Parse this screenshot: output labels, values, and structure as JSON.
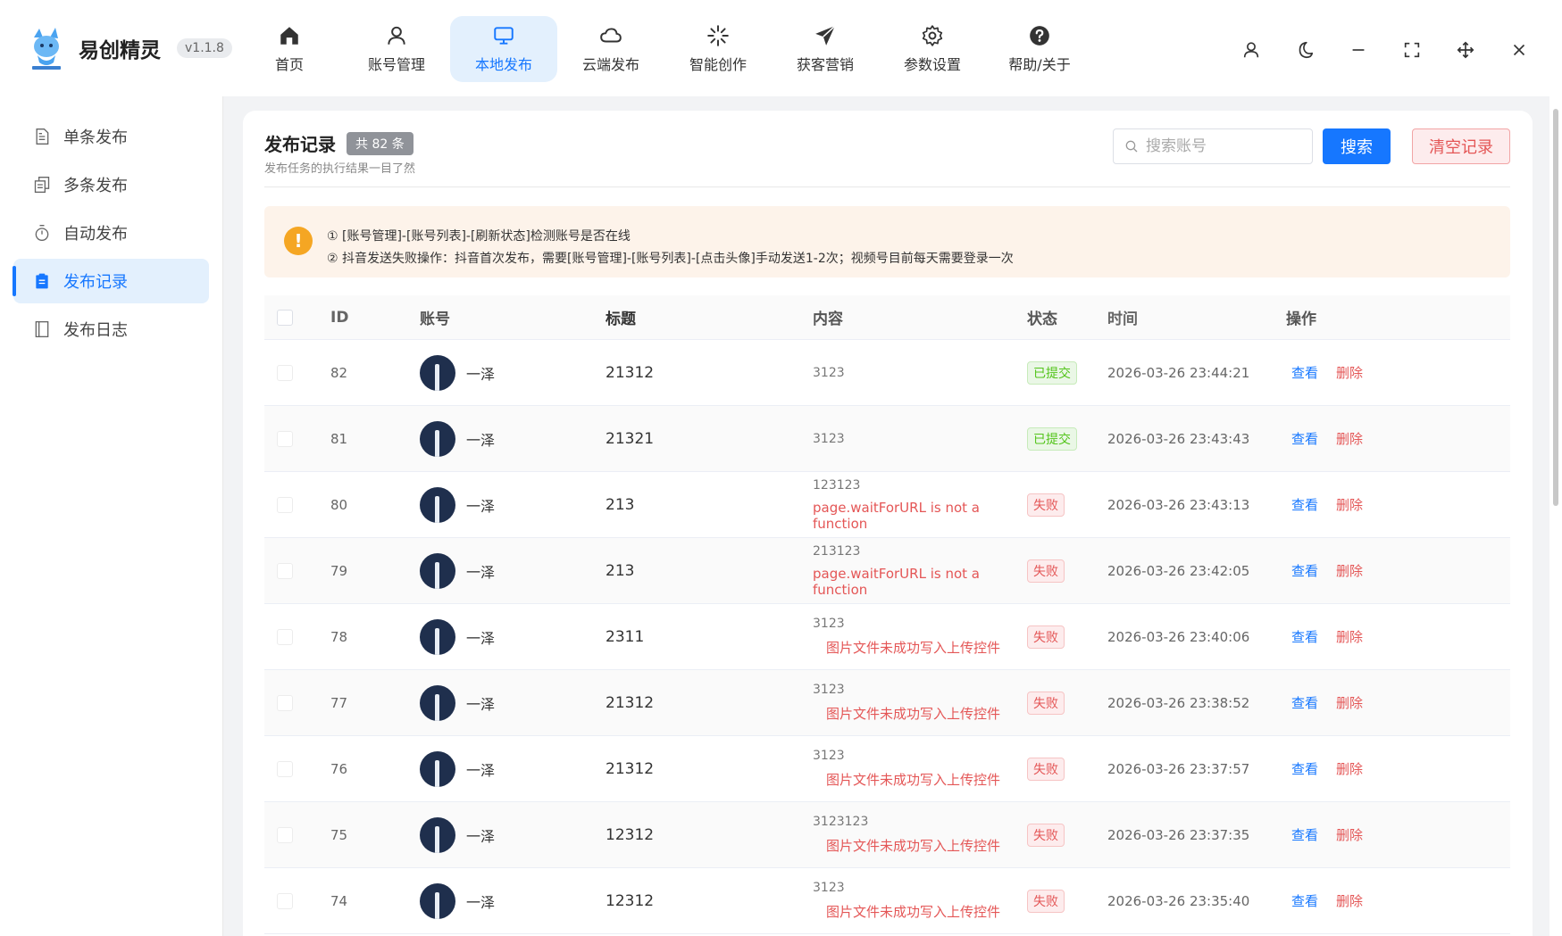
{
  "app": {
    "name": "易创精灵",
    "version": "v1.1.8"
  },
  "nav": [
    {
      "label": "首页",
      "icon": "home-icon",
      "active": false
    },
    {
      "label": "账号管理",
      "icon": "user-icon",
      "active": false
    },
    {
      "label": "本地发布",
      "icon": "monitor-icon",
      "active": true
    },
    {
      "label": "云端发布",
      "icon": "cloud-icon",
      "active": false
    },
    {
      "label": "智能创作",
      "icon": "sparkle-icon",
      "active": false
    },
    {
      "label": "获客营销",
      "icon": "paper-plane-icon",
      "active": false
    },
    {
      "label": "参数设置",
      "icon": "gear-icon",
      "active": false
    },
    {
      "label": "帮助/关于",
      "icon": "question-icon",
      "active": false
    }
  ],
  "window_controls": [
    "user-icon",
    "moon-icon",
    "minimize-icon",
    "fullscreen-icon",
    "move-icon",
    "close-icon"
  ],
  "sidebar": [
    {
      "label": "单条发布",
      "icon": "document-icon",
      "active": false
    },
    {
      "label": "多条发布",
      "icon": "copy-icon",
      "active": false
    },
    {
      "label": "自动发布",
      "icon": "timer-icon",
      "active": false
    },
    {
      "label": "发布记录",
      "icon": "clipboard-icon",
      "active": true
    },
    {
      "label": "发布日志",
      "icon": "notebook-icon",
      "active": false
    }
  ],
  "main": {
    "title": "发布记录",
    "count_badge": "共 82 条",
    "subtitle": "发布任务的执行结果一目了然",
    "search_placeholder": "搜索账号",
    "search_button": "搜索",
    "clear_button": "清空记录",
    "notice": {
      "icon": "!",
      "line1": "① [账号管理]-[账号列表]-[刷新状态]检测账号是否在线",
      "line2": "② 抖音发送失败操作：抖音首次发布，需要[账号管理]-[账号列表]-[点击头像]手动发送1-2次；视频号目前每天需要登录一次"
    },
    "columns": [
      "ID",
      "账号",
      "标题",
      "内容",
      "状态",
      "时间",
      "操作"
    ],
    "op_view": "查看",
    "op_delete": "删除",
    "rows": [
      {
        "id": "82",
        "account": "一泽",
        "title": "21312",
        "content": "3123",
        "error": "",
        "status": "已提交",
        "ok": true,
        "time": "2026-03-26 23:44:21"
      },
      {
        "id": "81",
        "account": "一泽",
        "title": "21321",
        "content": "3123",
        "error": "",
        "status": "已提交",
        "ok": true,
        "time": "2026-03-26 23:43:43"
      },
      {
        "id": "80",
        "account": "一泽",
        "title": "213",
        "content": "123123",
        "error": "page.waitForURL is not a function",
        "status": "失败",
        "ok": false,
        "time": "2026-03-26 23:43:13"
      },
      {
        "id": "79",
        "account": "一泽",
        "title": "213",
        "content": "213123",
        "error": "page.waitForURL is not a function",
        "status": "失败",
        "ok": false,
        "time": "2026-03-26 23:42:05"
      },
      {
        "id": "78",
        "account": "一泽",
        "title": "2311",
        "content": "3123",
        "error": "图片文件未成功写入上传控件",
        "status": "失败",
        "ok": false,
        "time": "2026-03-26 23:40:06"
      },
      {
        "id": "77",
        "account": "一泽",
        "title": "21312",
        "content": "3123",
        "error": "图片文件未成功写入上传控件",
        "status": "失败",
        "ok": false,
        "time": "2026-03-26 23:38:52"
      },
      {
        "id": "76",
        "account": "一泽",
        "title": "21312",
        "content": "3123",
        "error": "图片文件未成功写入上传控件",
        "status": "失败",
        "ok": false,
        "time": "2026-03-26 23:37:57"
      },
      {
        "id": "75",
        "account": "一泽",
        "title": "12312",
        "content": "3123123",
        "error": "图片文件未成功写入上传控件",
        "status": "失败",
        "ok": false,
        "time": "2026-03-26 23:37:35"
      },
      {
        "id": "74",
        "account": "一泽",
        "title": "12312",
        "content": "3123",
        "error": "图片文件未成功写入上传控件",
        "status": "失败",
        "ok": false,
        "time": "2026-03-26 23:35:40"
      }
    ]
  },
  "colors": {
    "primary": "#1677ff",
    "danger": "#e45656",
    "success": "#52c41a",
    "notice_bg": "#fdf3ea",
    "warning": "#f5a623"
  }
}
